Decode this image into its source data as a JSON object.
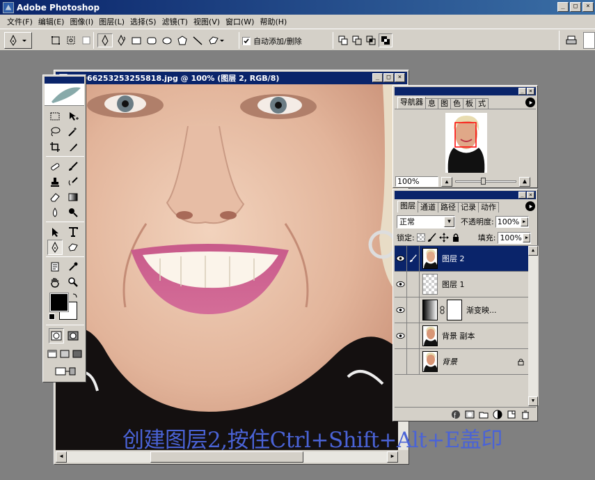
{
  "app": {
    "title": "Adobe Photoshop",
    "window_buttons": [
      "_",
      "□",
      "×"
    ]
  },
  "menu": {
    "items": [
      "文件(F)",
      "编辑(E)",
      "图像(I)",
      "图层(L)",
      "选择(S)",
      "滤镜(T)",
      "视图(V)",
      "窗口(W)",
      "帮助(H)"
    ]
  },
  "options_bar": {
    "auto_add_delete_label": "自动添加/删除",
    "auto_add_delete_checked": true
  },
  "document": {
    "title": "20066253253255818.jpg @ 100% (图层 2, RGB/8)"
  },
  "navigator": {
    "tabs": [
      "导航器",
      "息",
      "图",
      "色",
      "板",
      "式"
    ],
    "zoom": "100%"
  },
  "layers_panel": {
    "tabs": [
      "图层",
      "通道",
      "路径",
      "记录",
      "动作"
    ],
    "blend_mode": "正常",
    "opacity_label": "不透明度:",
    "opacity_value": "100%",
    "lock_label": "锁定:",
    "fill_label": "填充:",
    "fill_value": "100%",
    "layers": [
      {
        "name": "图层 2",
        "selected": true,
        "visible": true,
        "kind": "photo"
      },
      {
        "name": "图层 1",
        "selected": false,
        "visible": true,
        "kind": "transparent"
      },
      {
        "name": "渐变映...",
        "selected": false,
        "visible": true,
        "kind": "adjustment"
      },
      {
        "name": "背景 副本",
        "selected": false,
        "visible": true,
        "kind": "photo"
      },
      {
        "name": "背景",
        "selected": false,
        "visible": false,
        "kind": "photo",
        "locked": true
      }
    ]
  },
  "caption": {
    "text": "创建图层2,按住Ctrl+Shift+Alt+E盖印"
  },
  "colors": {
    "title_active": "#0a246a",
    "chrome": "#d4d0c8",
    "caption": "#4a63d6",
    "workspace": "#808080"
  }
}
